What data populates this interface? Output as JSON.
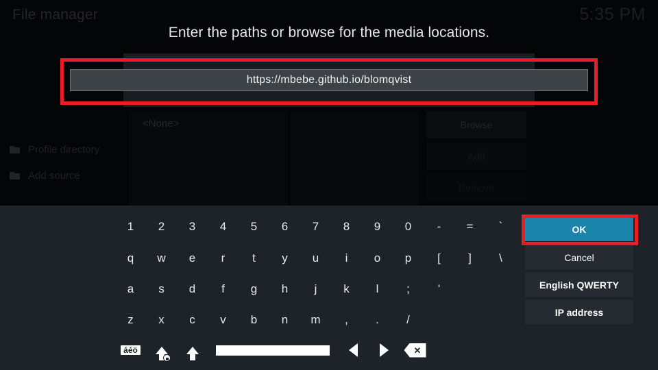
{
  "app": {
    "title": "File manager",
    "clock": "5:35 PM"
  },
  "background": {
    "sidebar_items": [
      {
        "label": "Profile directory",
        "icon": "folder-icon"
      },
      {
        "label": "Add source",
        "icon": "folder-icon"
      }
    ],
    "list_placeholder": "<None>",
    "action_buttons": [
      {
        "label": "Browse"
      },
      {
        "label": "Add"
      },
      {
        "label": "Remove"
      }
    ]
  },
  "dialog": {
    "heading": "Enter the paths or browse for the media locations.",
    "input": {
      "value": "https://mbebe.github.io/blomqvist",
      "placeholder": ""
    }
  },
  "keyboard": {
    "rows": [
      [
        "1",
        "2",
        "3",
        "4",
        "5",
        "6",
        "7",
        "8",
        "9",
        "0",
        "-",
        "=",
        "`"
      ],
      [
        "q",
        "w",
        "e",
        "r",
        "t",
        "y",
        "u",
        "i",
        "o",
        "p",
        "[",
        "]",
        "\\"
      ],
      [
        "a",
        "s",
        "d",
        "f",
        "g",
        "h",
        "j",
        "k",
        "l",
        ";",
        "'"
      ],
      [
        "z",
        "x",
        "c",
        "v",
        "b",
        "n",
        "m",
        ",",
        ".",
        "/"
      ]
    ],
    "special_keys": [
      {
        "name": "accents-key",
        "label": "áéö"
      },
      {
        "name": "caps-lock-key",
        "label": ""
      },
      {
        "name": "shift-key",
        "label": ""
      },
      {
        "name": "space-key",
        "label": ""
      },
      {
        "name": "cursor-left-key",
        "label": ""
      },
      {
        "name": "cursor-right-key",
        "label": ""
      },
      {
        "name": "backspace-key",
        "label": "✕"
      }
    ]
  },
  "side_buttons": {
    "ok": "OK",
    "cancel": "Cancel",
    "layout": "English QWERTY",
    "ip_address": "IP address"
  },
  "colors": {
    "accent": "#1a84ab",
    "annotation": "#ed1c24",
    "keyboard_panel": "#1d2328",
    "side_button": "#252b30",
    "input_bg": "#3c4246"
  }
}
